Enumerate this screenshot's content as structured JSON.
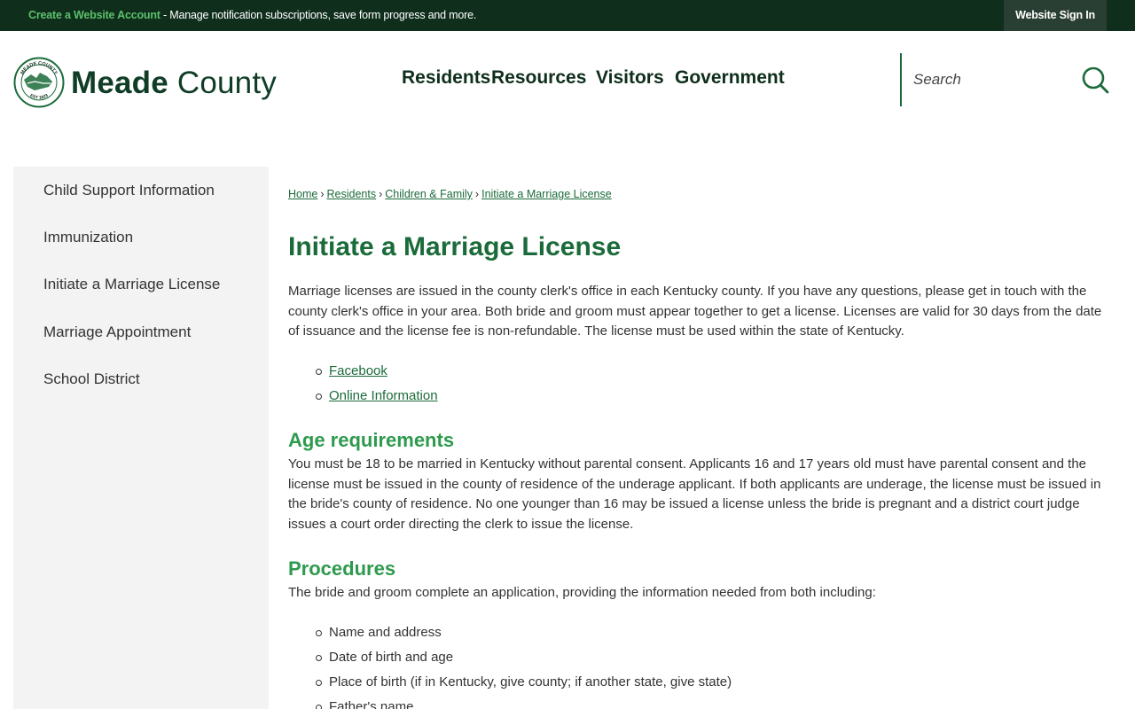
{
  "topbar": {
    "create_account_link": "Create a Website Account",
    "message": " - Manage notification subscriptions, save form progress and more.",
    "sign_in": "Website Sign In"
  },
  "header": {
    "logo": {
      "seal_top_text": "MEADE COUNTY",
      "seal_bottom_text": "EST 1823",
      "name_bold": "Meade",
      "name_light": "County"
    },
    "nav": [
      "Residents",
      "Resources",
      "Visitors",
      "Government"
    ],
    "search": {
      "placeholder": "Search"
    }
  },
  "sidebar": {
    "items": [
      "Child Support Information",
      "Immunization",
      "Initiate a Marriage License",
      "Marriage Appointment",
      "School District"
    ]
  },
  "breadcrumb": [
    "Home",
    "Residents",
    "Children & Family",
    "Initiate a Marriage License"
  ],
  "main": {
    "title": "Initiate a Marriage License",
    "intro": "Marriage licenses are issued in the county clerk's office in each Kentucky county. If you have any questions, please get in touch with the county clerk's office in your area. Both bride and groom must appear together to get a license. Licenses are valid for 30 days from the date of issuance and the license fee is non-refundable. The license must be used within the state of Kentucky.",
    "links": [
      "Facebook",
      "Online Information"
    ],
    "age_heading": "Age requirements",
    "age_text": "You must be 18 to be married in Kentucky without parental consent. Applicants 16 and 17 years old must have parental consent and the license must be issued in the county of residence of the underage applicant. If both applicants are underage, the license must be issued in the bride's county of residence. No one younger than 16 may be issued a license unless the bride is pregnant and a district court judge issues a court order directing the clerk to issue the license.",
    "procedures_heading": "Procedures",
    "procedures_text": "The bride and groom complete an application, providing the information needed from both including:",
    "procedures_items": [
      "Name and address",
      "Date of birth and age",
      "Place of birth (if in Kentucky, give county; if another state, give state)",
      "Father's name"
    ]
  },
  "colors": {
    "topbar_bg": "#0f2e1c",
    "accent_green": "#1b6b3a",
    "heading_green": "#2e9a4e",
    "sidebar_bg": "#f3f3f3"
  }
}
